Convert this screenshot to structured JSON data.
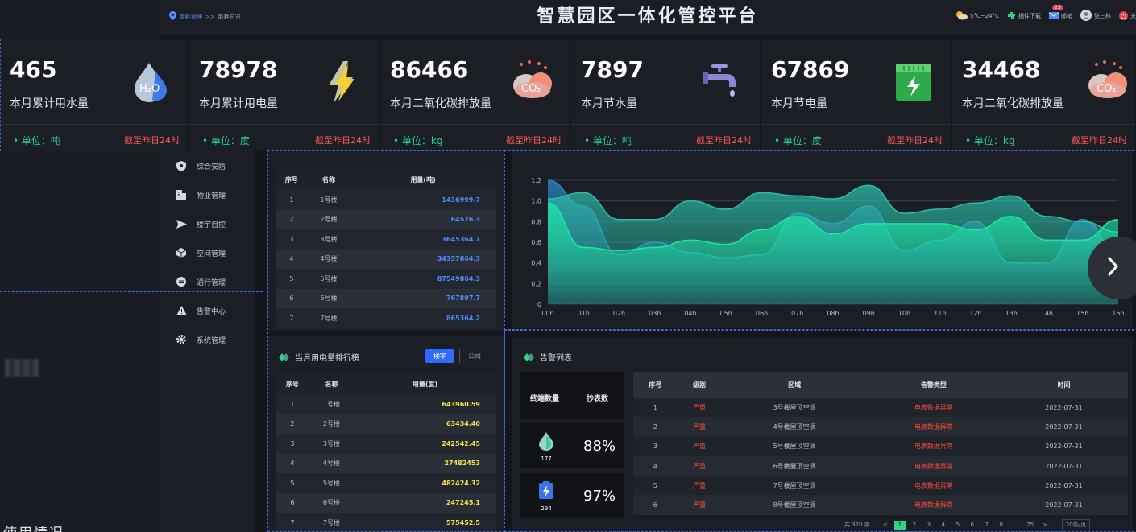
{
  "header": {
    "breadcrumb": {
      "link": "能耗管理",
      "sep": ">>",
      "current": "能耗总览"
    },
    "title": "智慧园区一体化管控平台",
    "weather": "5°C~24°C",
    "plugin": "插件下载",
    "mail": "邮箱",
    "mail_badge": "23",
    "user": "张三林",
    "power": "关"
  },
  "stats": [
    {
      "value": "465",
      "label": "本月累计用水量",
      "unit": "• 单位：吨",
      "cutoff": "截至昨日24时",
      "icon": "water-drop-icon"
    },
    {
      "value": "78978",
      "label": "本月累计用电量",
      "unit": "• 单位：度",
      "cutoff": "截至昨日24时",
      "icon": "lightning-icon"
    },
    {
      "value": "86466",
      "label": "本月二氧化碳排放量",
      "unit": "• 单位：kg",
      "cutoff": "截至昨日24时",
      "icon": "co2-cloud-icon"
    },
    {
      "value": "7897",
      "label": "本月节水量",
      "unit": "• 单位：吨",
      "cutoff": "截至昨日24时",
      "icon": "faucet-icon"
    },
    {
      "value": "67869",
      "label": "本月节电量",
      "unit": "• 单位：度",
      "cutoff": "截至昨日24时",
      "icon": "battery-charge-icon"
    },
    {
      "value": "34468",
      "label": "本月二氧化碳排放量",
      "unit": "• 单位：kg",
      "cutoff": "截至昨日24时",
      "icon": "co2-cloud-icon"
    }
  ],
  "menu": [
    {
      "label": "综合安防",
      "icon": "shield-icon"
    },
    {
      "label": "物业管理",
      "icon": "building-icon"
    },
    {
      "label": "楼宇自控",
      "icon": "plane-icon"
    },
    {
      "label": "空间管理",
      "icon": "cube-icon"
    },
    {
      "label": "通行管理",
      "icon": "pass-icon"
    },
    {
      "label": "告警中心",
      "icon": "warning-icon"
    },
    {
      "label": "系统管理",
      "icon": "gear-icon"
    }
  ],
  "water_rank": {
    "columns": [
      "序号",
      "名称",
      "用量(吨)"
    ],
    "rows": [
      [
        "1",
        "1号楼",
        "1436999.7"
      ],
      [
        "2",
        "2号楼",
        "64576.3"
      ],
      [
        "3",
        "3号楼",
        "3645364.7"
      ],
      [
        "4",
        "4号楼",
        "34357864.3"
      ],
      [
        "5",
        "5号楼",
        "87549864.3"
      ],
      [
        "6",
        "6号楼",
        "767897.7"
      ],
      [
        "7",
        "7号楼",
        "865364.2"
      ]
    ]
  },
  "elec_rank": {
    "title": "当月用电量排行榜",
    "tabs": [
      "楼宇",
      "公司"
    ],
    "columns": [
      "序号",
      "名称",
      "用量(度)"
    ],
    "rows": [
      [
        "1",
        "1号楼",
        "643960.59"
      ],
      [
        "2",
        "2号楼",
        "63434.40"
      ],
      [
        "3",
        "3号楼",
        "242542.45"
      ],
      [
        "4",
        "4号楼",
        "27482453"
      ],
      [
        "5",
        "5号楼",
        "482424.32"
      ],
      [
        "6",
        "6号楼",
        "247245.1"
      ],
      [
        "7",
        "7号楼",
        "575452.5"
      ]
    ]
  },
  "alerts": {
    "title": "告警列表",
    "summary_headers": [
      "终端数量",
      "抄表数"
    ],
    "water_count": "177",
    "water_pct": "88%",
    "elec_count": "294",
    "elec_pct": "97%",
    "columns": [
      "序号",
      "级别",
      "区域",
      "告警类型",
      "时间"
    ],
    "rows": [
      [
        "1",
        "严重",
        "3号楼屋顶空调",
        "电表数据异常",
        "2022-07-31"
      ],
      [
        "2",
        "严重",
        "4号楼屋顶空调",
        "电表数据异常",
        "2022-07-31"
      ],
      [
        "3",
        "严重",
        "5号楼屋顶空调",
        "电表数据异常",
        "2022-07-31"
      ],
      [
        "4",
        "严重",
        "6号楼屋顶空调",
        "电表数据异常",
        "2022-07-31"
      ],
      [
        "5",
        "严重",
        "7号楼屋顶空调",
        "电表数据异常",
        "2022-07-31"
      ],
      [
        "6",
        "严重",
        "8号楼屋顶空调",
        "电表数据异常",
        "2022-07-31"
      ]
    ],
    "pager": {
      "total": "共 320 条",
      "prev": "<",
      "pages": [
        "1",
        "2",
        "3",
        "4",
        "5",
        "6",
        "7",
        "8",
        "...",
        "25"
      ],
      "next": ">",
      "size": "20条/页"
    }
  },
  "left_bottom_text": "使用情况",
  "chart_data": {
    "type": "area",
    "x": [
      "00h",
      "01h",
      "02h",
      "03h",
      "04h",
      "05h",
      "06h",
      "07h",
      "08h",
      "09h",
      "10h",
      "11h",
      "12h",
      "13h",
      "14h",
      "15h",
      "16h"
    ],
    "ylim": [
      0,
      1.2
    ],
    "yticks": [
      "0",
      "0.2",
      "0.4",
      "0.6",
      "0.8",
      "1.0",
      "1.2"
    ],
    "series": [
      {
        "values": [
          0.98,
          0.55,
          0.52,
          0.55,
          0.62,
          0.58,
          0.72,
          0.85,
          0.68,
          0.78,
          0.78,
          0.78,
          0.72,
          0.85,
          0.62,
          0.62,
          0.82
        ],
        "color": "#1de9a6"
      },
      {
        "values": [
          1.02,
          1.08,
          0.82,
          0.82,
          1.0,
          0.92,
          1.08,
          1.05,
          1.02,
          1.15,
          0.88,
          0.92,
          0.98,
          1.05,
          0.85,
          0.8,
          0.7
        ],
        "color": "#2bbfa9"
      },
      {
        "values": [
          1.2,
          0.95,
          0.48,
          0.6,
          0.5,
          0.45,
          0.48,
          0.88,
          0.78,
          0.95,
          0.52,
          0.62,
          0.8,
          0.4,
          0.4,
          0.82,
          0.5
        ],
        "color": "#2d88c6"
      }
    ]
  }
}
